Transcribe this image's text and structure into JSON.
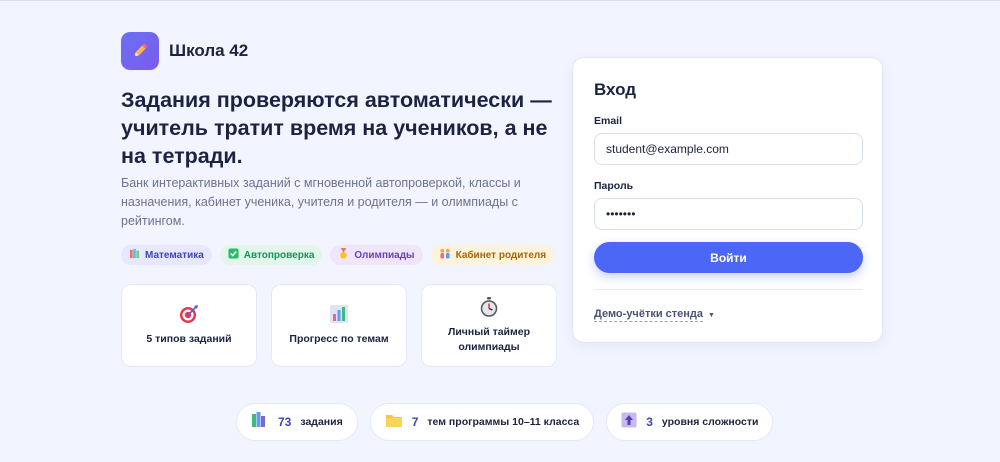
{
  "brand": {
    "name": "Школа 42",
    "logo_icon": "pencil-icon",
    "logo_color": "#6b6ff2"
  },
  "hero": {
    "title": "Задания проверяются автоматически — учитель тратит время на учеников, а не на тетради.",
    "subtitle": "Банк интерактивных заданий с мгновенной автопроверкой, классы и назначения, кабинет ученика, учителя и родителя — и олимпиады с рейтингом."
  },
  "chips": [
    {
      "label": "Математика",
      "icon": "books-icon"
    },
    {
      "label": "Автопроверка",
      "icon": "check-icon"
    },
    {
      "label": "Олимпиады",
      "icon": "medal-icon"
    },
    {
      "label": "Кабинет родителя",
      "icon": "family-icon"
    }
  ],
  "features": [
    {
      "label": "5 типов заданий",
      "icon": "target-icon"
    },
    {
      "label": "Прогресс по темам",
      "icon": "bar-chart-icon"
    },
    {
      "label": "Личный таймер олимпиады",
      "icon": "stopwatch-icon"
    }
  ],
  "stats": [
    {
      "value": "73",
      "label": "задания",
      "icon": "books-stack-icon"
    },
    {
      "value": "7",
      "label": "тем программы 10–11 класса",
      "icon": "folder-icon"
    },
    {
      "value": "3",
      "label": "уровня сложности",
      "icon": "up-arrow-icon"
    }
  ],
  "login": {
    "title": "Вход",
    "email_label": "Email",
    "email_value": "student@example.com",
    "password_label": "Пароль",
    "password_value": "•••••••",
    "submit_label": "Войти",
    "demo_link": "Демо-учётки стенда",
    "accent_color": "#4c67f5"
  }
}
